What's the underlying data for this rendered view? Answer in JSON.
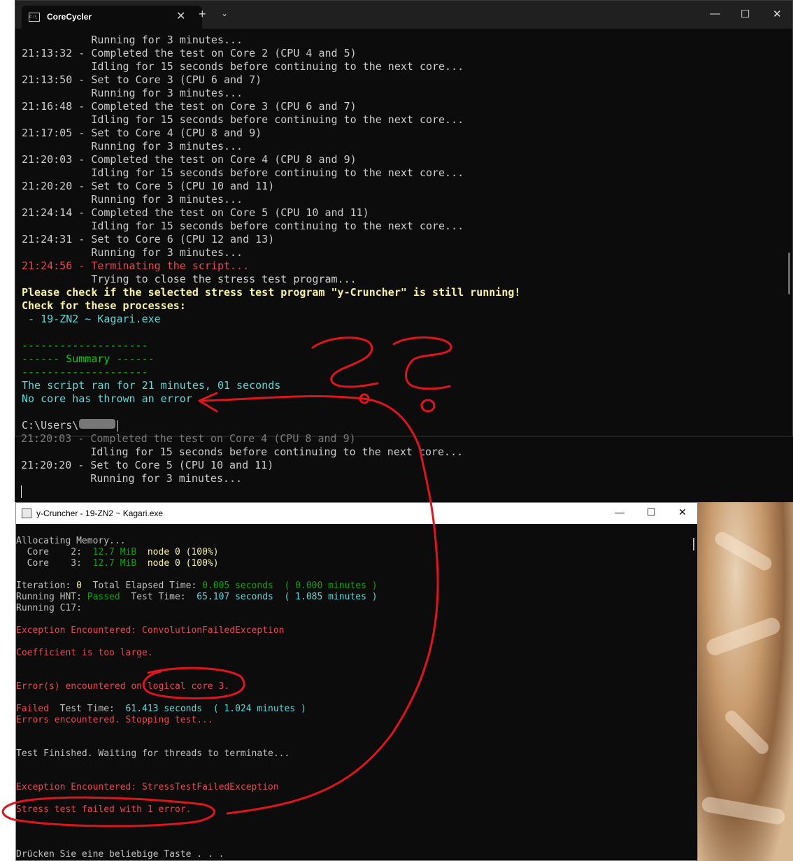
{
  "terminal": {
    "tab_title": "CoreCycler",
    "tab_icon_text": "C:\\",
    "close_tab_glyph": "✕",
    "new_tab_glyph": "+",
    "dropdown_glyph": "⌄",
    "minimize_glyph": "—",
    "maximize_glyph": "☐",
    "close_glyph": "✕",
    "lines": [
      "           Running for 3 minutes...",
      "21:13:32 - Completed the test on Core 2 (CPU 4 and 5)",
      "           Idling for 15 seconds before continuing to the next core...",
      "21:13:50 - Set to Core 3 (CPU 6 and 7)",
      "           Running for 3 minutes...",
      "21:16:48 - Completed the test on Core 3 (CPU 6 and 7)",
      "           Idling for 15 seconds before continuing to the next core...",
      "21:17:05 - Set to Core 4 (CPU 8 and 9)",
      "           Running for 3 minutes...",
      "21:20:03 - Completed the test on Core 4 (CPU 8 and 9)",
      "           Idling for 15 seconds before continuing to the next core...",
      "21:20:20 - Set to Core 5 (CPU 10 and 11)",
      "           Running for 3 minutes...",
      "21:24:14 - Completed the test on Core 5 (CPU 10 and 11)",
      "           Idling for 15 seconds before continuing to the next core...",
      "21:24:31 - Set to Core 6 (CPU 12 and 13)",
      "           Running for 3 minutes..."
    ],
    "terminating_line": "21:24:56 - Terminating the script...",
    "closing_line": "           Trying to close the stress test program...",
    "check_line": "Please check if the selected stress test program \"y-Cruncher\" is still running!",
    "processes_line": "Check for these processes:",
    "process_item": " - 19-ZN2 ~ Kagari.exe",
    "divider": "--------------------",
    "summary_header": "------ Summary ------",
    "ran_line": "The script ran for 21 minutes, 01 seconds",
    "no_error_line": "No core has thrown an error",
    "prompt": "C:\\Users\\",
    "background_lines": [
      "21:20:03 - Completed the test on Core 4 (CPU 8 and 9)",
      "           Idling for 15 seconds before continuing to the next core...",
      "21:20:20 - Set to Core 5 (CPU 10 and 11)",
      "           Running for 3 minutes..."
    ]
  },
  "ycruncher": {
    "title": "y-Cruncher - 19-ZN2 ~ Kagari.exe",
    "minimize_glyph": "—",
    "maximize_glyph": "☐",
    "close_glyph": "✕",
    "l1": "Allocating Memory...",
    "core2_a": "  Core    2:  ",
    "core2_b": "12.7 MiB",
    "core2_c": "  node 0 (100%)",
    "core3_a": "  Core    3:  ",
    "core3_b": "12.7 MiB",
    "core3_c": "  node 0 (100%)",
    "it_a": "Iteration: ",
    "it_b": "0",
    "it_c": "  Total Elapsed Time: ",
    "it_d": "0.005 seconds",
    "it_e": "  ( 0.000 minutes )",
    "hnt_a": "Running HNT: ",
    "hnt_b": "Passed",
    "hnt_c": "  Test Time:  ",
    "hnt_d": "65.107 seconds",
    "hnt_e": "  ( 1.085 minutes )",
    "c17": "Running C17:",
    "exc1": "Exception Encountered: ConvolutionFailedException",
    "coeff": "Coefficient is too large.",
    "err_core": "Error(s) encountered on logical core 3.",
    "failed_a": "Failed",
    "failed_b": "  Test Time:  ",
    "failed_c": "61.413 seconds",
    "failed_d": "  ( 1.024 minutes )",
    "stopping": "Errors encountered. Stopping test...",
    "finished": "Test Finished. Waiting for threads to terminate...",
    "exc2": "Exception Encountered: StressTestFailedException",
    "stress_fail": "Stress test failed with 1 error.",
    "press_key": "Drücken Sie eine beliebige Taste . . ."
  },
  "colors": {
    "terminal_bg": "#0c0c0c",
    "annotation_red": "#e0141c",
    "error_red": "#e74856",
    "summary_green": "#16c60c",
    "info_cyan": "#61d6d6",
    "warning_yellow": "#f9f1a5"
  }
}
